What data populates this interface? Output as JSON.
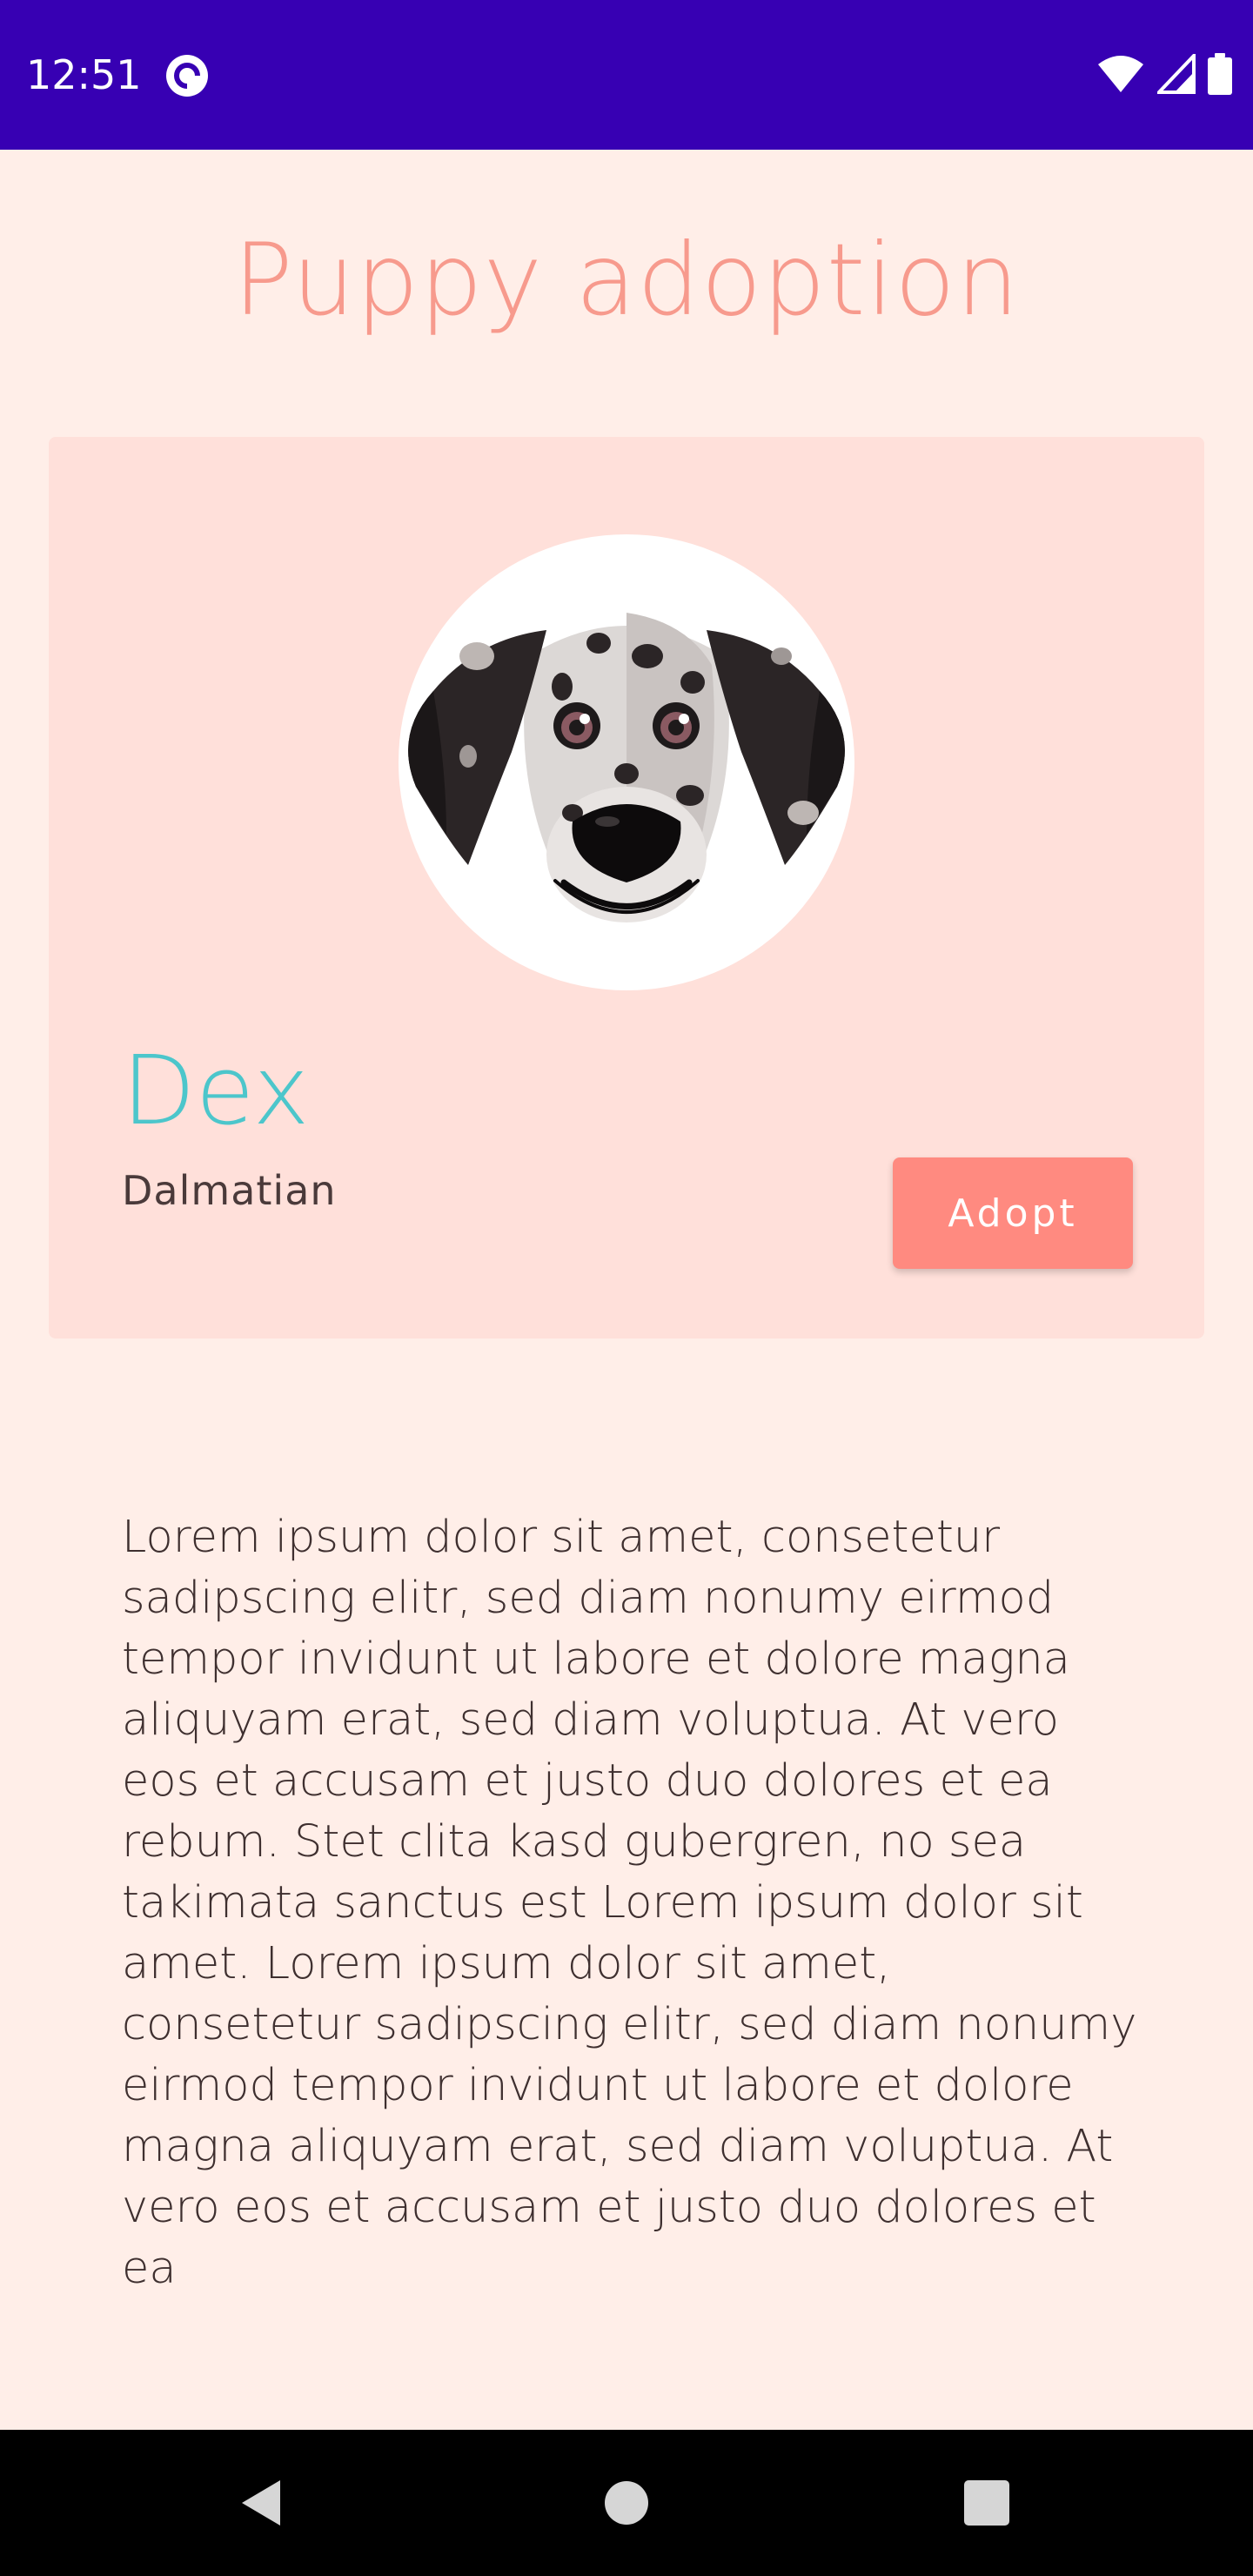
{
  "status_bar": {
    "time": "12:51",
    "app_icon": "pocket-casts-icon",
    "icons": [
      "wifi-icon",
      "cellular-signal-icon",
      "battery-icon"
    ],
    "background": "#3700B3"
  },
  "header": {
    "title": "Puppy adoption",
    "title_color": "#F79A8D"
  },
  "pet_card": {
    "image": "dalmatian-dog-face-icon",
    "name": "Dex",
    "breed": "Dalmatian",
    "adopt_label": "Adopt",
    "card_color": "#FFE0DA",
    "name_color": "#4CC6CB",
    "button_color": "#FF8A80"
  },
  "description": "Lorem ipsum dolor sit amet, consetetur sadipscing elitr, sed diam nonumy eirmod tempor invidunt ut labore et dolore magna aliquyam erat, sed diam voluptua. At vero eos et accusam et justo duo dolores et ea rebum. Stet clita kasd gubergren, no sea takimata sanctus est Lorem ipsum dolor sit amet. Lorem ipsum dolor sit amet, consetetur sadipscing elitr, sed diam nonumy eirmod tempor invidunt ut labore et dolore magna aliquyam erat, sed diam voluptua. At vero eos et accusam et justo duo dolores et ea",
  "nav_bar": {
    "buttons": [
      "back-icon",
      "home-icon",
      "recents-icon"
    ]
  },
  "colors": {
    "page_background": "#FFEEE8",
    "text": "#3E2F2F"
  }
}
